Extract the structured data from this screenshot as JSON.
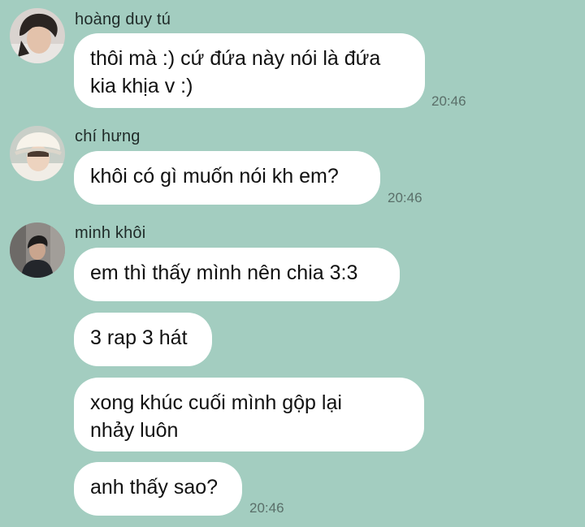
{
  "chat": {
    "groups": [
      {
        "sender": "hoàng duy tú",
        "messages": [
          "thôi mà :) cứ đứa này nói là đứa\nkia khịa v :)"
        ],
        "time": "20:46"
      },
      {
        "sender": "chí hưng",
        "messages": [
          "khôi có gì muốn nói kh em?"
        ],
        "time": "20:46"
      },
      {
        "sender": "minh khôi",
        "messages": [
          "em thì thấy mình nên chia 3:3",
          "3 rap 3 hát",
          "xong khúc cuối mình gộp lại\nnhảy luôn",
          "anh thấy sao?"
        ],
        "time": "20:46"
      }
    ]
  },
  "colors": {
    "background": "#a3cdc0",
    "bubble": "#ffffff",
    "timestamp": "#5a6f69"
  },
  "icons": {
    "avatar_1": "user-avatar-photo",
    "avatar_2": "user-avatar-photo",
    "avatar_3": "user-avatar-photo"
  }
}
